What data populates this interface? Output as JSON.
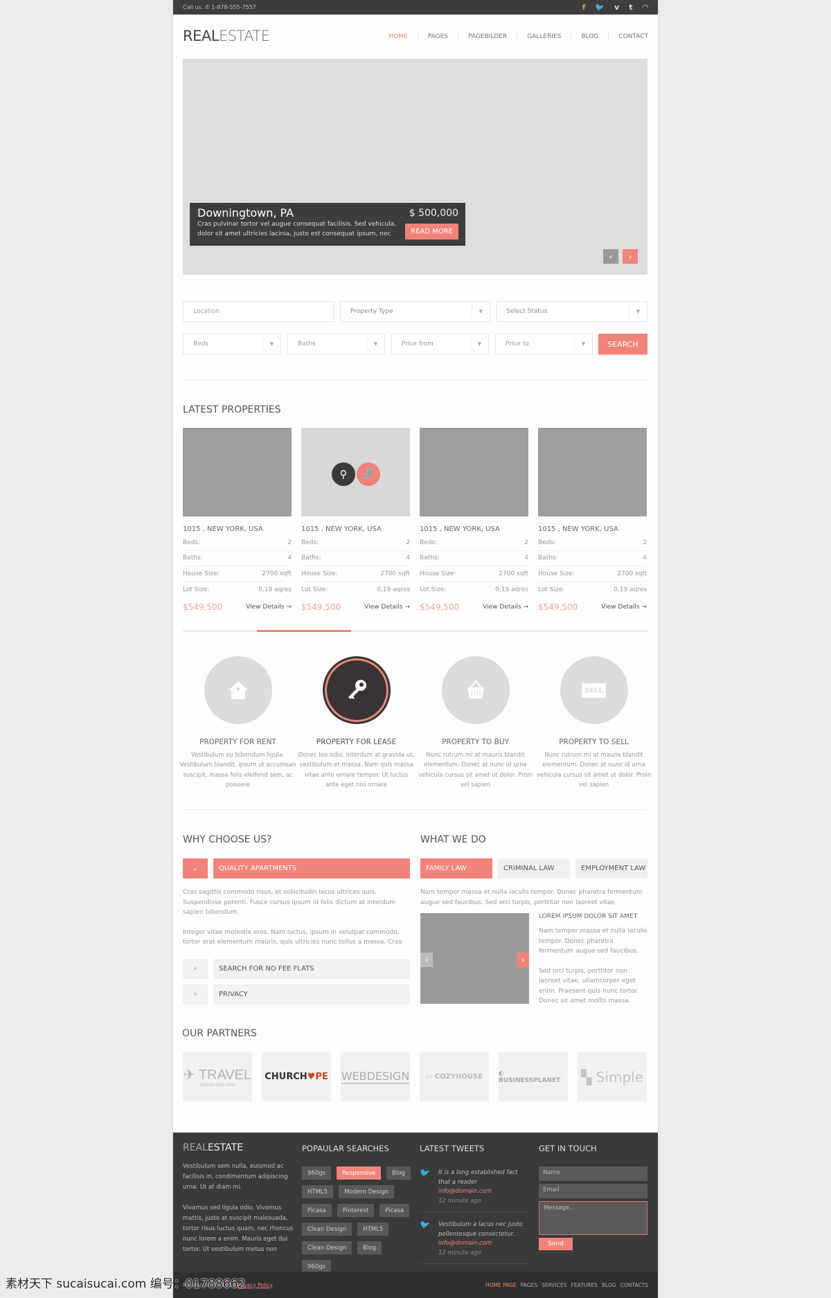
{
  "topbar": {
    "call_label": "Call us:",
    "phone": "1-878-555-7557",
    "social": [
      {
        "icon": "facebook-icon",
        "glyph": "f",
        "active": true
      },
      {
        "icon": "twitter-icon",
        "glyph": "🐦"
      },
      {
        "icon": "vimeo-icon",
        "glyph": "v"
      },
      {
        "icon": "tumblr-icon",
        "glyph": "t"
      },
      {
        "icon": "rss-icon",
        "glyph": "◠"
      }
    ]
  },
  "header": {
    "logo_a": "REAL",
    "logo_b": "ESTATE",
    "nav": [
      {
        "label": "HOME",
        "active": true
      },
      {
        "label": "PAGES"
      },
      {
        "label": "PAGEBILDER"
      },
      {
        "label": "GALLERIES"
      },
      {
        "label": "BLOG"
      },
      {
        "label": "CONTACT"
      }
    ]
  },
  "hero": {
    "title": "Downingtown, PA",
    "price": "$ 500,000",
    "text": "Cras pulvinar tortor vel augue consequat facilisis. Sed vehicula, dolor sit amet ultricies lacinia, justo est consequat ipsum, nec",
    "read_more": "READ MORE"
  },
  "search": {
    "location": "Location",
    "property_type": "Property Type",
    "status": "Select Status",
    "beds": "Beds",
    "baths": "Baths",
    "price_from": "Price from",
    "price_to": "Price to",
    "button": "SEARCH"
  },
  "latest": {
    "title": "LATEST PROPERTIES",
    "carousel_position": 0.2,
    "cards": [
      {
        "address": "1015 , NEW YORK, USA",
        "beds_label": "Beds:",
        "beds": "2",
        "baths_label": "Baths:",
        "baths": "4",
        "house_label": "House Size:",
        "house": "2700 sqft",
        "lot_label": "Lot Size:",
        "lot": "0,19 aqres",
        "price": "$549,500",
        "details": "View Details →"
      },
      {
        "address": "1015 , NEW YORK, USA",
        "beds_label": "Beds:",
        "beds": "2",
        "baths_label": "Baths:",
        "baths": "4",
        "house_label": "House Size:",
        "house": "2700 sqft",
        "lot_label": "Lot Size:",
        "lot": "0,19 aqres",
        "price": "$549,500",
        "details": "View Details →",
        "hover": true
      },
      {
        "address": "1015 , NEW YORK, USA",
        "beds_label": "Beds:",
        "beds": "2",
        "baths_label": "Baths:",
        "baths": "4",
        "house_label": "House Size:",
        "house": "2700 sqft",
        "lot_label": "Lot Size:",
        "lot": "0,19 aqres",
        "price": "$549,500",
        "details": "View Details →"
      },
      {
        "address": "1015 , NEW YORK, USA",
        "beds_label": "Beds:",
        "beds": "2",
        "baths_label": "Baths:",
        "baths": "4",
        "house_label": "House Size:",
        "house": "2700 sqft",
        "lot_label": "Lot Size:",
        "lot": "0,19 aqres",
        "price": "$549,500",
        "details": "View Details →"
      }
    ]
  },
  "services": [
    {
      "title": "PROPERTY FOR RENT",
      "text": "Vestibulum eu bibendum ligula. Vestibulum blandit, ipsum ut accumsan suscipit, massa felis eleifend sem, ac posuere",
      "icon": "house-icon"
    },
    {
      "title": "PROPERTY FOR LEASE",
      "text": "Donec leo odio, interdum at gravida ut, vestibulum et massa. Nam quis massa vitae ante ornare tempor. Ut luctus ante eget nisi ornare",
      "icon": "key-icon",
      "active": true
    },
    {
      "title": "PROPERTY TO BUY",
      "text": "Nunc rutrum mi at mauris blandit elementum. Donec at nunc id urna vehicula cursus sit amet ut dolor. Proin vel sapien",
      "icon": "basket-icon"
    },
    {
      "title": "PROPERTY TO SELL",
      "text": "Nunc rutrum mi at mauris blandit elementum. Donec at nunc id urna vehicula cursus sit amet ut dolor. Proin vel sapien",
      "icon": "sell-sign-icon",
      "sign_text": "SELL"
    }
  ],
  "why": {
    "title": "WHY CHOOSE US?",
    "open_item": "QUALITY APARTMENTS",
    "p1": "Cras sagittis commodo risus, et sollicitudin lacus ultrices quis. Suspendisse potenti. Fusce cursus ipsum id felis dictum at interdum sapien bibendum.",
    "p2": "Integer vitae molestie eros. Nam luctus, ipsum in volutpat commodo, tortor erat elementum mauris, quis ultricies nunc tellus a massa. Cras",
    "items": [
      "SEARCH FOR NO FEE FLATS",
      "PRIVACY"
    ]
  },
  "what": {
    "title": "WHAT WE DO",
    "tabs": [
      {
        "label": "FAMILY LAW",
        "active": true
      },
      {
        "label": "CRIMINAL LAW"
      },
      {
        "label": "EMPLOYMENT LAW"
      }
    ],
    "intro": "Nam tempor massa et nulla iaculis tempor. Donec pharetra fermentum augue sed faucibus. Sed orci turpis, porttitor non laoreet vitae,",
    "sub_title": "LOREM IPSUM DOLOR SIT AMET",
    "sub_p1": "Nam tempor massa et nulla iaculis tempor. Donec pharetra fermentum augue sed faucibus.",
    "sub_p2": "Sed orci turpis, porttitor non laoreet vitae, ullamcorper eget enim. Praesent quis nunc tortor. Donec sit amet mollis massa."
  },
  "partners": {
    "title": "OUR PARTNERS",
    "logos": [
      "TRAVEL",
      "SLOGAN GOES HERE",
      "CHURCH",
      "PE",
      "WEBDESIGN",
      "COZY",
      "HOUSE",
      "BUSINESSPLANET",
      "Simple"
    ]
  },
  "footer": {
    "logo_a": "REAL",
    "logo_b": "ESTATE",
    "about_p1": "Vestibulum sem nulla, euismod ac facilisis in, condimentum adipiscing urna. Ut at diam mi.",
    "about_p2": "Vivamus sed ligula odio. Vivamus mattis, justo at suscipit malesuada, tortor risus luctus quam, nec rhoncus nunc lorem a enim. Mauris eget dui tortor. Ut vestibulum metus non",
    "searches_title": "POPAULAR SEARCHES",
    "tags": [
      {
        "label": "960gs"
      },
      {
        "label": "Responsive",
        "active": true
      },
      {
        "label": "Blog"
      },
      {
        "label": "HTML5"
      },
      {
        "label": "Modern Design"
      },
      {
        "label": "Picasa"
      },
      {
        "label": "Pinterest"
      },
      {
        "label": "Picasa"
      },
      {
        "label": "Clean Design"
      },
      {
        "label": "HTML5"
      },
      {
        "label": "Clean Design"
      },
      {
        "label": "Blog"
      },
      {
        "label": "960gs"
      }
    ],
    "tweets_title": "LATEST TWEETS",
    "tweets": [
      {
        "text": "It is a long established fact that a reader",
        "email": "info@domain.com",
        "time": "12 minute ago"
      },
      {
        "text": "Vestibulum a lacus nec justo pellentesque consectetur.",
        "email": "info@domain.com",
        "time": "12 minute ago"
      }
    ],
    "contact_title": "GET IN TOUCH",
    "name_ph": "Name",
    "email_ph": "Email",
    "message_ph": "Message..",
    "send": "Send",
    "copyright": "RealEstate © 2020 |",
    "privacy": "Privacy Policy",
    "nav": [
      {
        "label": "HOME PAGE",
        "active": true
      },
      {
        "label": "PAGES"
      },
      {
        "label": "SERVICES"
      },
      {
        "label": "FEATURES"
      },
      {
        "label": "BLOG"
      },
      {
        "label": "CONTACTS"
      }
    ]
  },
  "watermark": "素材天下 sucaisucai.com  编号：01788662",
  "colors": {
    "accent": "#f2837a",
    "dark": "#3d3d3d"
  }
}
